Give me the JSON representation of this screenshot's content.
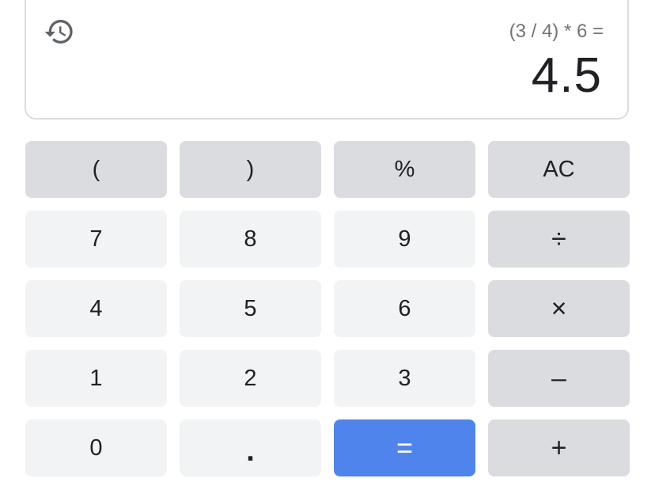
{
  "display": {
    "history_icon": "history-icon",
    "expression": "(3 / 4) * 6 =",
    "result": "4.5"
  },
  "keys": [
    {
      "label": "(",
      "kind": "op",
      "name": "key-open-paren"
    },
    {
      "label": ")",
      "kind": "op",
      "name": "key-close-paren"
    },
    {
      "label": "%",
      "kind": "op",
      "name": "key-percent"
    },
    {
      "label": "AC",
      "kind": "op",
      "name": "key-all-clear"
    },
    {
      "label": "7",
      "kind": "num",
      "name": "key-7"
    },
    {
      "label": "8",
      "kind": "num",
      "name": "key-8"
    },
    {
      "label": "9",
      "kind": "num",
      "name": "key-9"
    },
    {
      "label": "÷",
      "kind": "op",
      "name": "key-divide"
    },
    {
      "label": "4",
      "kind": "num",
      "name": "key-4"
    },
    {
      "label": "5",
      "kind": "num",
      "name": "key-5"
    },
    {
      "label": "6",
      "kind": "num",
      "name": "key-6"
    },
    {
      "label": "×",
      "kind": "op",
      "name": "key-multiply"
    },
    {
      "label": "1",
      "kind": "num",
      "name": "key-1"
    },
    {
      "label": "2",
      "kind": "num",
      "name": "key-2"
    },
    {
      "label": "3",
      "kind": "num",
      "name": "key-3"
    },
    {
      "label": "–",
      "kind": "op",
      "name": "key-subtract"
    },
    {
      "label": "0",
      "kind": "num",
      "name": "key-0"
    },
    {
      "label": ".",
      "kind": "num",
      "name": "key-decimal"
    },
    {
      "label": "=",
      "kind": "eq",
      "name": "key-equals"
    },
    {
      "label": "+",
      "kind": "op",
      "name": "key-add"
    }
  ],
  "colors": {
    "equals_button": "#4f84ec",
    "operator_key": "#dadce0",
    "number_key": "#f1f3f4",
    "expression_text": "#70757a",
    "result_text": "#202124"
  }
}
